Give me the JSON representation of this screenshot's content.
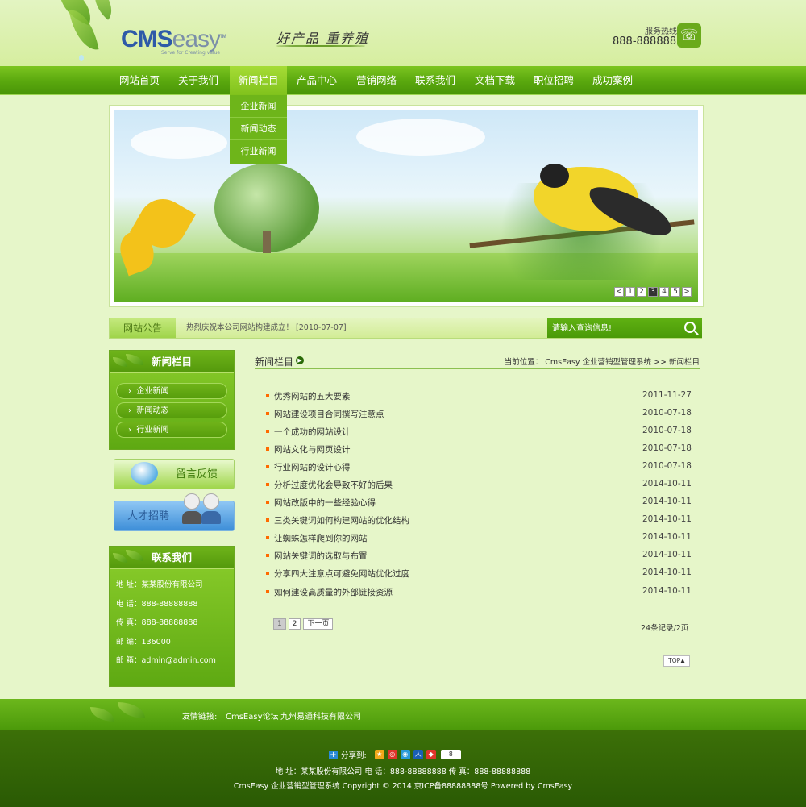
{
  "header": {
    "logo_main": "CMS",
    "logo_easy": "easy",
    "logo_tm": "TM",
    "logo_tagline": "Serve for Creating value",
    "slogan": "好产品 重养殖",
    "hotline_label": "服务热线",
    "hotline_number": "888-88888888"
  },
  "nav": {
    "items": [
      {
        "label": "网站首页"
      },
      {
        "label": "关于我们"
      },
      {
        "label": "新闻栏目"
      },
      {
        "label": "产品中心"
      },
      {
        "label": "营销网络"
      },
      {
        "label": "联系我们"
      },
      {
        "label": "文档下载"
      },
      {
        "label": "职位招聘"
      },
      {
        "label": "成功案例"
      }
    ],
    "dropdown": [
      {
        "label": "企业新闻"
      },
      {
        "label": "新闻动态"
      },
      {
        "label": "行业新闻"
      }
    ]
  },
  "banner": {
    "pager": [
      "<",
      "1",
      "2",
      "3",
      "4",
      "5",
      ">"
    ],
    "active_page": "3"
  },
  "notice": {
    "label": "网站公告",
    "text": "热烈庆祝本公司网站构建成立！ [2010-07-07]",
    "search_placeholder": "请输入查询信息!"
  },
  "sidebar": {
    "news_title": "新闻栏目",
    "news_items": [
      {
        "label": "企业新闻"
      },
      {
        "label": "新闻动态"
      },
      {
        "label": "行业新闻"
      }
    ],
    "feedback_label": "留言反馈",
    "jobs_label": "人才招聘",
    "contact_title": "联系我们",
    "contact_lines": [
      "地 址：某某股份有限公司",
      "电 话：888-88888888",
      "传 真：888-88888888",
      "邮 编：136000",
      "邮 箱：admin@admin.com"
    ]
  },
  "main": {
    "title": "新闻栏目",
    "breadcrumb": "当前位置： CmsEasy 企业营销型管理系统  >> 新闻栏目",
    "news": [
      {
        "title": "优秀网站的五大要素",
        "date": "2011-11-27"
      },
      {
        "title": "网站建设项目合同撰写注意点",
        "date": "2010-07-18"
      },
      {
        "title": "一个成功的网站设计",
        "date": "2010-07-18"
      },
      {
        "title": "网站文化与网页设计",
        "date": "2010-07-18"
      },
      {
        "title": "行业网站的设计心得",
        "date": "2010-07-18"
      },
      {
        "title": "分析过度优化会导致不好的后果",
        "date": "2014-10-11"
      },
      {
        "title": "网站改版中的一些经验心得",
        "date": "2014-10-11"
      },
      {
        "title": "三类关键词如何构建网站的优化结构",
        "date": "2014-10-11"
      },
      {
        "title": "让蜘蛛怎样爬到你的网站",
        "date": "2014-10-11"
      },
      {
        "title": "网站关键词的选取与布置",
        "date": "2014-10-11"
      },
      {
        "title": "分享四大注意点可避免网站优化过度",
        "date": "2014-10-11"
      },
      {
        "title": "如何建设高质量的外部链接资源",
        "date": "2014-10-11"
      }
    ],
    "pagination": {
      "page1": "1",
      "page2": "2",
      "next": "下一页"
    },
    "record_count": "24条记录/2页",
    "top_label": "TOP▲"
  },
  "footer": {
    "links_label": "友情链接:",
    "links": [
      "CmsEasy论坛",
      "九州易通科技有限公司"
    ],
    "share_label": "分享到:",
    "share_count": "8",
    "address_line": "地 址：某某股份有限公司    电 话：888-88888888    传 真：888-88888888",
    "copyright_line": "CmsEasy 企业营销型管理系统 Copyright © 2014 京ICP备88888888号 Powered by CmsEasy"
  }
}
